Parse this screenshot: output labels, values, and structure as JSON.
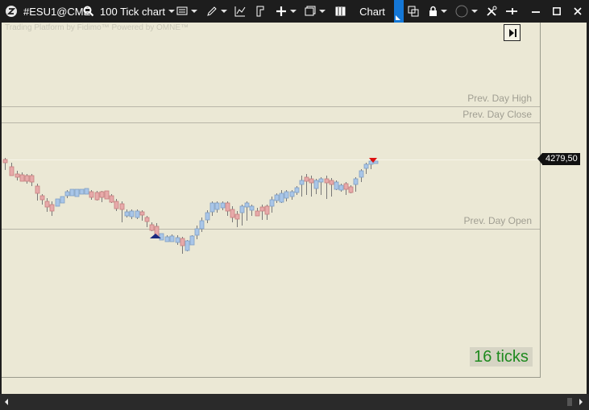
{
  "toolbar": {
    "symbol": "#ESU1@CME",
    "timeframe": "100 Tick chart",
    "chart_tab": "Chart"
  },
  "chart": {
    "watermark": "Trading Platform by Fidimo™  Powered by OMNE™",
    "levels": {
      "prev_high": "Prev. Day High",
      "prev_close": "Prev. Day Close",
      "prev_open": "Prev. Day Open"
    },
    "last_price": "4279,50",
    "ticks_remaining": "16 ticks"
  },
  "colors": {
    "background": "#ebe8d5",
    "up_candle": "#a9c6e8",
    "down_candle": "#e7aaaa",
    "ticks_text": "#1e8a1e"
  }
}
